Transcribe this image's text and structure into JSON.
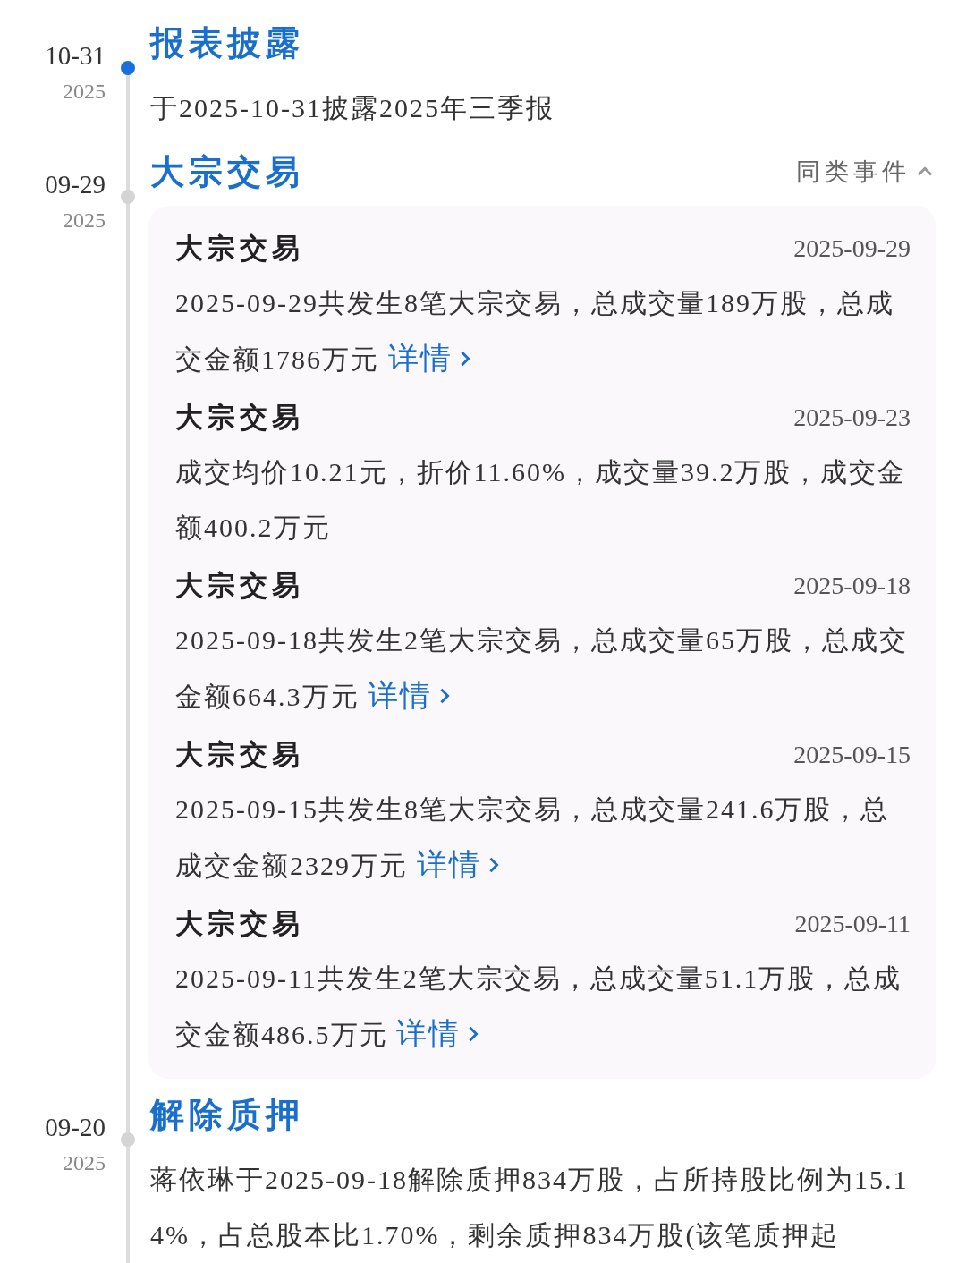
{
  "events": [
    {
      "date": "10-31",
      "year": "2025",
      "highlighted": true,
      "title": "报表披露",
      "text": "于2025-10-31披露2025年三季报"
    },
    {
      "date": "09-29",
      "year": "2025",
      "highlighted": false,
      "title": "大宗交易",
      "related": {
        "label": "同类事件",
        "expanded": true
      },
      "items": [
        {
          "title": "大宗交易",
          "date": "2025-09-29",
          "text": "2025-09-29共发生8笔大宗交易，总成交量189万股，总成交金额1786万元",
          "link": "详情"
        },
        {
          "title": "大宗交易",
          "date": "2025-09-23",
          "text": "成交均价10.21元，折价11.60%，成交量39.2万股，成交金额400.2万元"
        },
        {
          "title": "大宗交易",
          "date": "2025-09-18",
          "text": "2025-09-18共发生2笔大宗交易，总成交量65万股，总成交金额664.3万元",
          "link": "详情"
        },
        {
          "title": "大宗交易",
          "date": "2025-09-15",
          "text": "2025-09-15共发生8笔大宗交易，总成交量241.6万股，总成交金额2329万元",
          "link": "详情"
        },
        {
          "title": "大宗交易",
          "date": "2025-09-11",
          "text": "2025-09-11共发生2笔大宗交易，总成交量51.1万股，总成交金额486.5万元",
          "link": "详情"
        }
      ]
    },
    {
      "date": "09-20",
      "year": "2025",
      "highlighted": false,
      "title": "解除质押",
      "text": "蒋依琳于2025-09-18解除质押834万股，占所持股比例为15.14%，占总股本比1.70%，剩余质押834万股(该笔质押起"
    }
  ]
}
